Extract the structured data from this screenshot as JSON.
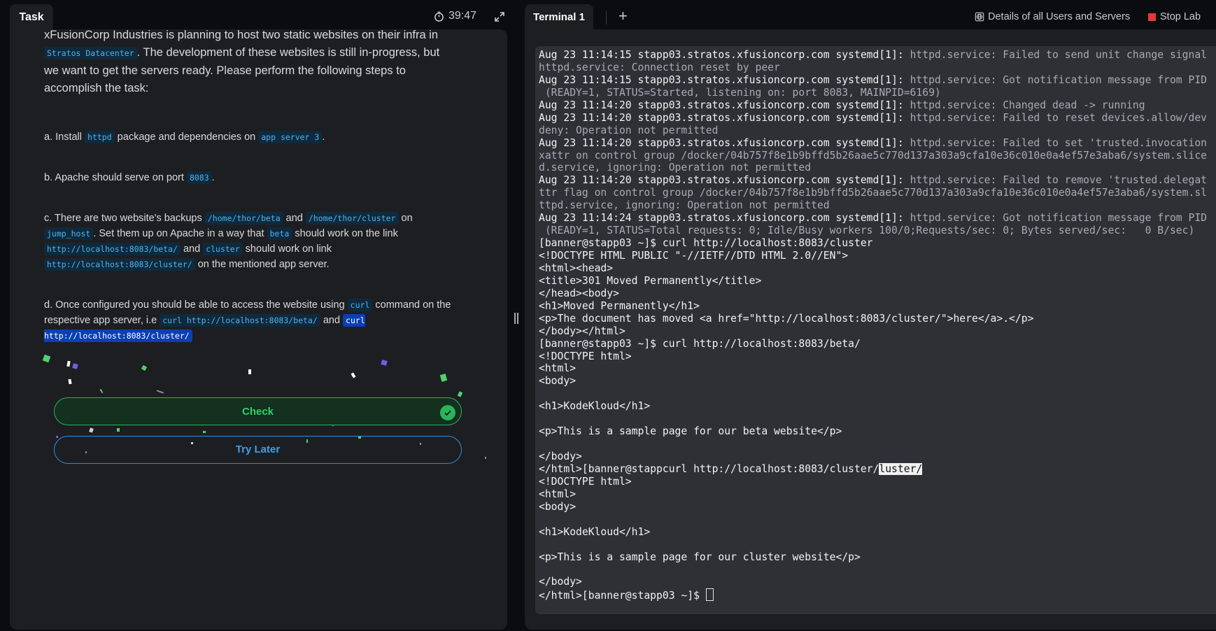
{
  "task_tab": {
    "label": "Task"
  },
  "timer": {
    "value": "39:47"
  },
  "task": {
    "intro": [
      {
        "t": "xFusionCorp Industries is planning to host two static websites on their infra in "
      },
      {
        "c": "Stratos Datacenter"
      },
      {
        "t": ". The development of these websites is still in-progress, but we want to get the servers ready. Please perform the following steps to accomplish the task:"
      }
    ],
    "steps": [
      [
        {
          "t": "a. Install "
        },
        {
          "c": "httpd"
        },
        {
          "t": " package and dependencies on "
        },
        {
          "c": "app server 3"
        },
        {
          "t": "."
        }
      ],
      [
        {
          "t": "b. Apache should serve on port "
        },
        {
          "c": "8083"
        },
        {
          "t": "."
        }
      ],
      [
        {
          "t": "c. There are two website's backups "
        },
        {
          "c": "/home/thor/beta"
        },
        {
          "t": " and "
        },
        {
          "c": "/home/thor/cluster"
        },
        {
          "t": " on "
        },
        {
          "c": "jump_host"
        },
        {
          "t": ". Set them up on Apache in a way that "
        },
        {
          "c": "beta"
        },
        {
          "t": " should work on the link "
        },
        {
          "c": "http://localhost:8083/beta/"
        },
        {
          "t": " and "
        },
        {
          "c": "cluster"
        },
        {
          "t": " should work on link "
        },
        {
          "c": "http://localhost:8083/cluster/"
        },
        {
          "t": " on the mentioned app server."
        }
      ],
      [
        {
          "t": "d. Once configured you should be able to access the website using "
        },
        {
          "c": "curl"
        },
        {
          "t": " command on the respective app server, i.e "
        },
        {
          "c": "curl http://localhost:8083/beta/"
        },
        {
          "t": " and "
        },
        {
          "s": "curl  http://localhost:8083/cluster/"
        }
      ]
    ],
    "check_label": "Check",
    "try_later_label": "Try Later"
  },
  "terminal": {
    "tab_label": "Terminal 1",
    "add_tab": "+",
    "details_label": "Details of all Users and Servers",
    "stop_lab_label": "Stop Lab",
    "lines": [
      [
        {
          "t": "Aug 23 11:14:15 stapp03.stratos.xfusioncorp.com systemd[1]: "
        },
        {
          "d": "httpd.service: Failed to send unit change signal"
        }
      ],
      [
        {
          "d": "httpd.service: Connection reset by peer"
        }
      ],
      [
        {
          "t": "Aug 23 11:14:15 stapp03.stratos.xfusioncorp.com systemd[1]: "
        },
        {
          "d": "httpd.service: Got notification message from PID"
        }
      ],
      [
        {
          "d": " (READY=1, STATUS=Started, listening on: port 8083, MAINPID=6169)"
        }
      ],
      [
        {
          "t": "Aug 23 11:14:20 stapp03.stratos.xfusioncorp.com systemd[1]: "
        },
        {
          "d": "httpd.service: Changed dead -> running"
        }
      ],
      [
        {
          "t": "Aug 23 11:14:20 stapp03.stratos.xfusioncorp.com systemd[1]: "
        },
        {
          "d": "httpd.service: Failed to reset devices.allow/dev"
        }
      ],
      [
        {
          "d": "deny: Operation not permitted"
        }
      ],
      [
        {
          "t": "Aug 23 11:14:20 stapp03.stratos.xfusioncorp.com systemd[1]: "
        },
        {
          "d": "httpd.service: Failed to set 'trusted.invocation"
        }
      ],
      [
        {
          "d": "xattr on control group /docker/04b757f8e1b9bffd5b26aae5c770d137a303a9cfa10e36c010e0a4ef57e3aba6/system.slice"
        }
      ],
      [
        {
          "d": "d.service, ignoring: Operation not permitted"
        }
      ],
      [
        {
          "t": "Aug 23 11:14:20 stapp03.stratos.xfusioncorp.com systemd[1]: "
        },
        {
          "d": "httpd.service: Failed to remove 'trusted.delegat"
        }
      ],
      [
        {
          "d": "ttr flag on control group /docker/04b757f8e1b9bffd5b26aae5c770d137a303a9cfa10e36c010e0a4ef57e3aba6/system.sl"
        }
      ],
      [
        {
          "d": "ttpd.service, ignoring: Operation not permitted"
        }
      ],
      [
        {
          "t": "Aug 23 11:14:24 stapp03.stratos.xfusioncorp.com systemd[1]: "
        },
        {
          "d": "httpd.service: Got notification message from PID"
        }
      ],
      [
        {
          "d": " (READY=1, STATUS=Total requests: 0; Idle/Busy workers 100/0;Requests/sec: 0; Bytes served/sec:   0 B/sec)"
        }
      ],
      [
        {
          "t": "[banner@stapp03 ~]$ curl http://localhost:8083/cluster"
        }
      ],
      [
        {
          "t": "<!DOCTYPE HTML PUBLIC \"-//IETF//DTD HTML 2.0//EN\">"
        }
      ],
      [
        {
          "t": "<html><head>"
        }
      ],
      [
        {
          "t": "<title>301 Moved Permanently</title>"
        }
      ],
      [
        {
          "t": "</head><body>"
        }
      ],
      [
        {
          "t": "<h1>Moved Permanently</h1>"
        }
      ],
      [
        {
          "t": "<p>The document has moved <a href=\"http://localhost:8083/cluster/\">here</a>.</p>"
        }
      ],
      [
        {
          "t": "</body></html>"
        }
      ],
      [
        {
          "t": "[banner@stapp03 ~]$ curl http://localhost:8083/beta/"
        }
      ],
      [
        {
          "t": "<!DOCTYPE html>"
        }
      ],
      [
        {
          "t": "<html>"
        }
      ],
      [
        {
          "t": "<body>"
        }
      ],
      [
        {
          "t": ""
        }
      ],
      [
        {
          "t": "<h1>KodeKloud</h1>"
        }
      ],
      [
        {
          "t": ""
        }
      ],
      [
        {
          "t": "<p>This is a sample page for our beta website</p>"
        }
      ],
      [
        {
          "t": ""
        }
      ],
      [
        {
          "t": "</body>"
        }
      ],
      [
        {
          "t": "</html>[banner@stappcurl http://localhost:8083/cluster/"
        },
        {
          "h": "luster/"
        }
      ],
      [
        {
          "t": "<!DOCTYPE html>"
        }
      ],
      [
        {
          "t": "<html>"
        }
      ],
      [
        {
          "t": "<body>"
        }
      ],
      [
        {
          "t": ""
        }
      ],
      [
        {
          "t": "<h1>KodeKloud</h1>"
        }
      ],
      [
        {
          "t": ""
        }
      ],
      [
        {
          "t": "<p>This is a sample page for our cluster website</p>"
        }
      ],
      [
        {
          "t": ""
        }
      ],
      [
        {
          "t": "</body>"
        }
      ],
      [
        {
          "t": "</html>[banner@stapp03 ~]$ "
        },
        {
          "cursor": true
        }
      ]
    ]
  },
  "colors": {
    "accent_green": "#2bb35b",
    "accent_blue": "#2b8de0",
    "code_text": "#4fb3ee",
    "stop_red": "#e53935"
  },
  "icons": [
    "stopwatch-icon",
    "expand-icon",
    "plus-icon",
    "globe-icon",
    "stop-square-icon",
    "checkmark-icon",
    "drag-handle-icon"
  ]
}
